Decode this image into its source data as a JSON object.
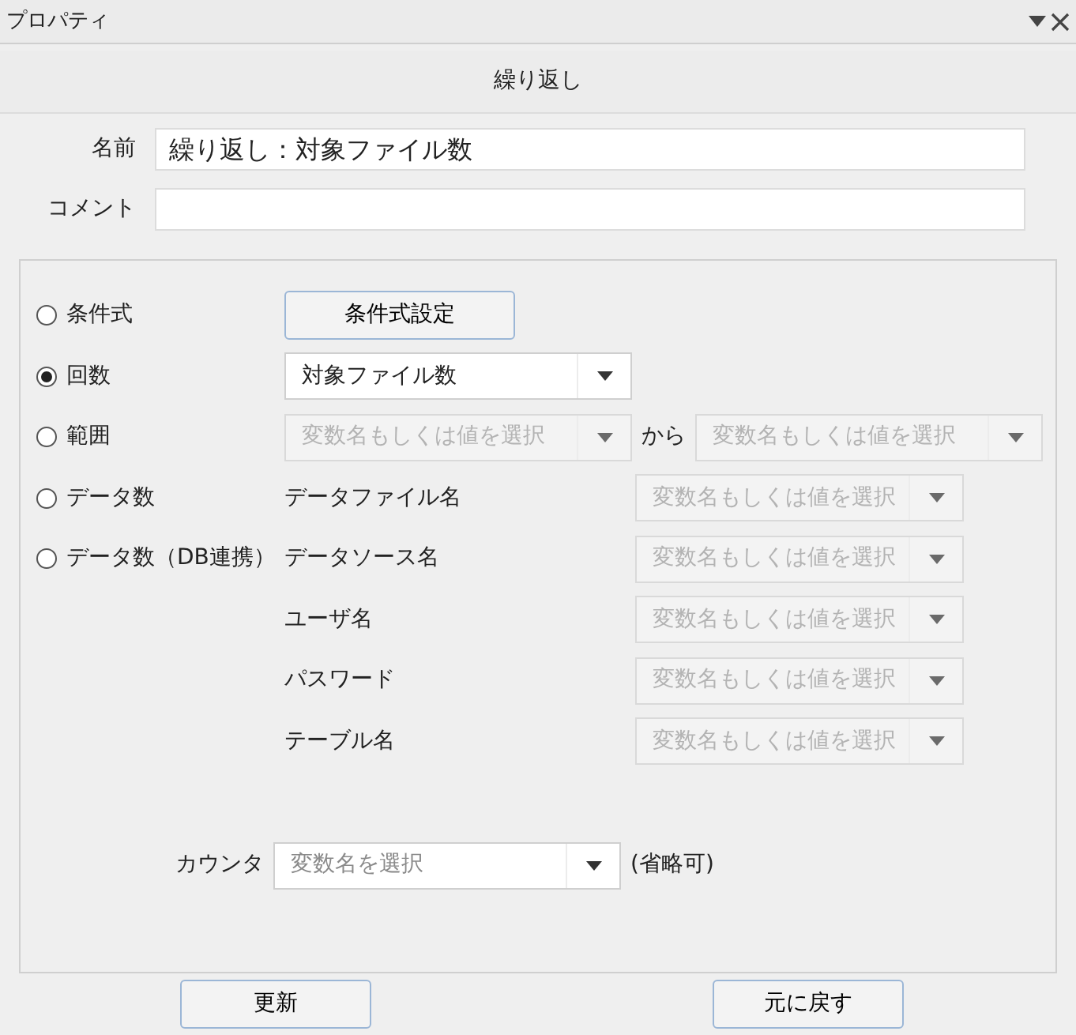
{
  "panel": {
    "title": "プロパティ",
    "header": "繰り返し"
  },
  "fields": [
    {
      "label": "名前",
      "value": "繰り返し：対象ファイル数"
    },
    {
      "label": "コメント"
    }
  ],
  "options": [
    {
      "kind": "button",
      "label": "条件式",
      "selected": false,
      "button": "条件式設定"
    },
    {
      "kind": "combo",
      "label": "回数",
      "selected": true,
      "combo": {
        "value": "対象ファイル数",
        "disabled": false
      }
    },
    {
      "kind": "range",
      "label": "範囲",
      "selected": false,
      "from": {
        "placeholder": "変数名もしくは値を選択",
        "disabled": true
      },
      "separator": "から",
      "to": {
        "placeholder": "変数名もしくは値を選択",
        "disabled": true
      }
    },
    {
      "kind": "params",
      "label": "データ数",
      "selected": false,
      "params": [
        {
          "label": "データファイル名",
          "placeholder": "変数名もしくは値を選択",
          "disabled": true
        }
      ]
    },
    {
      "kind": "params",
      "label": "データ数（DB連携）",
      "selected": false,
      "params": [
        {
          "label": "データソース名",
          "placeholder": "変数名もしくは値を選択",
          "disabled": true
        },
        {
          "label": "ユーザ名",
          "placeholder": "変数名もしくは値を選択",
          "disabled": true
        },
        {
          "label": "パスワード",
          "placeholder": "変数名もしくは値を選択",
          "disabled": true
        },
        {
          "label": "テーブル名",
          "placeholder": "変数名もしくは値を選択",
          "disabled": true
        }
      ]
    }
  ],
  "counter": {
    "label": "カウンタ",
    "placeholder": "変数名を選択",
    "note": "(省略可)",
    "disabled": false
  },
  "buttons": [
    "更新",
    "元に戻す"
  ]
}
